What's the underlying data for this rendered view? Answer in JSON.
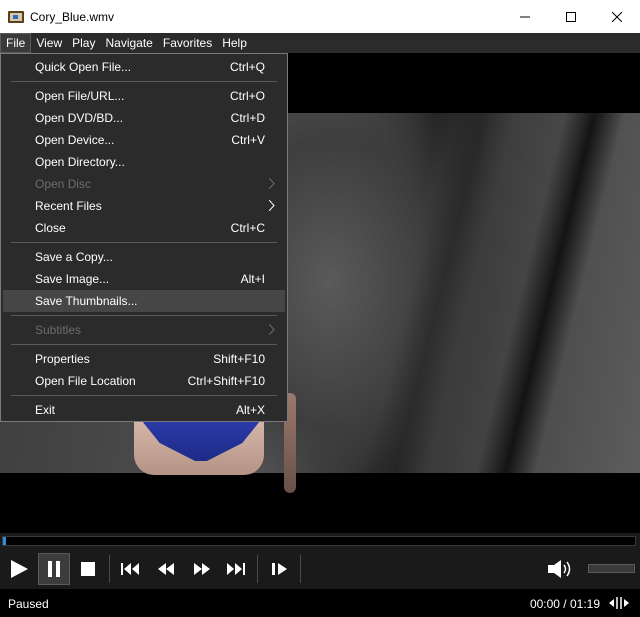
{
  "window": {
    "title": "Cory_Blue.wmv",
    "icons": {
      "app": "film-strip-icon",
      "minimize": "minimize-icon",
      "maximize": "maximize-icon",
      "close": "close-icon"
    }
  },
  "menubar": {
    "items": [
      {
        "label": "File",
        "active": true
      },
      {
        "label": "View"
      },
      {
        "label": "Play"
      },
      {
        "label": "Navigate"
      },
      {
        "label": "Favorites"
      },
      {
        "label": "Help"
      }
    ]
  },
  "file_menu": {
    "quick_open": {
      "label": "Quick Open File...",
      "shortcut": "Ctrl+Q"
    },
    "open_file": {
      "label": "Open File/URL...",
      "shortcut": "Ctrl+O"
    },
    "open_dvd": {
      "label": "Open DVD/BD...",
      "shortcut": "Ctrl+D"
    },
    "open_device": {
      "label": "Open Device...",
      "shortcut": "Ctrl+V"
    },
    "open_directory": {
      "label": "Open Directory...",
      "shortcut": ""
    },
    "open_disc": {
      "label": "Open Disc",
      "shortcut": "",
      "disabled": true,
      "submenu": true
    },
    "recent_files": {
      "label": "Recent Files",
      "shortcut": "",
      "submenu": true
    },
    "close": {
      "label": "Close",
      "shortcut": "Ctrl+C"
    },
    "save_copy": {
      "label": "Save a Copy...",
      "shortcut": ""
    },
    "save_image": {
      "label": "Save Image...",
      "shortcut": "Alt+I"
    },
    "save_thumbnails": {
      "label": "Save Thumbnails...",
      "shortcut": "",
      "hovered": true
    },
    "subtitles": {
      "label": "Subtitles",
      "shortcut": "",
      "disabled": true,
      "submenu": true
    },
    "properties": {
      "label": "Properties",
      "shortcut": "Shift+F10"
    },
    "open_file_location": {
      "label": "Open File Location",
      "shortcut": "Ctrl+Shift+F10"
    },
    "exit": {
      "label": "Exit",
      "shortcut": "Alt+X"
    }
  },
  "seekbar": {
    "progress_fraction": 0.005,
    "fill_color": "#2b8fd6"
  },
  "controls": {
    "icons": [
      "play-icon",
      "pause-icon",
      "stop-icon",
      "skip-back-icon",
      "rewind-icon",
      "fast-forward-icon",
      "skip-forward-icon",
      "frame-step-icon",
      "volume-icon"
    ],
    "pause_active": true
  },
  "status": {
    "state": "Paused",
    "time": "00:00 / 01:19",
    "icons": {
      "network": "network-activity-icon"
    }
  }
}
